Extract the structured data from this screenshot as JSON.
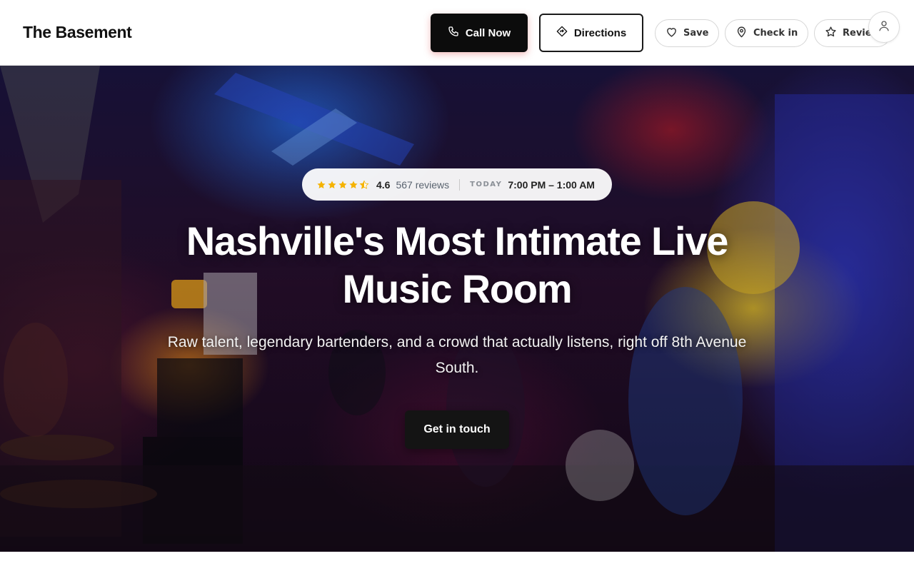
{
  "header": {
    "brand": "The Basement",
    "call_label": "Call Now",
    "directions_label": "Directions",
    "save_label": "Save",
    "checkin_label": "Check in",
    "review_label": "Review"
  },
  "hero": {
    "rating": {
      "stars": 4.5,
      "value": "4.6",
      "reviews": "567 reviews",
      "day_label": "TODAY",
      "hours": "7:00 PM – 1:00 AM"
    },
    "headline": "Nashville's Most Intimate Live Music Room",
    "subheadline": "Raw talent, legendary bartenders, and a crowd that actually listens, right off 8th Avenue South.",
    "cta_label": "Get in touch"
  },
  "colors": {
    "star": "#f5b301",
    "primary_button": "#0c0c0c"
  },
  "icons": {
    "call": "phone-icon",
    "directions": "directions-icon",
    "save": "heart-icon",
    "checkin": "map-pin-icon",
    "review": "star-icon",
    "account": "user-icon"
  }
}
